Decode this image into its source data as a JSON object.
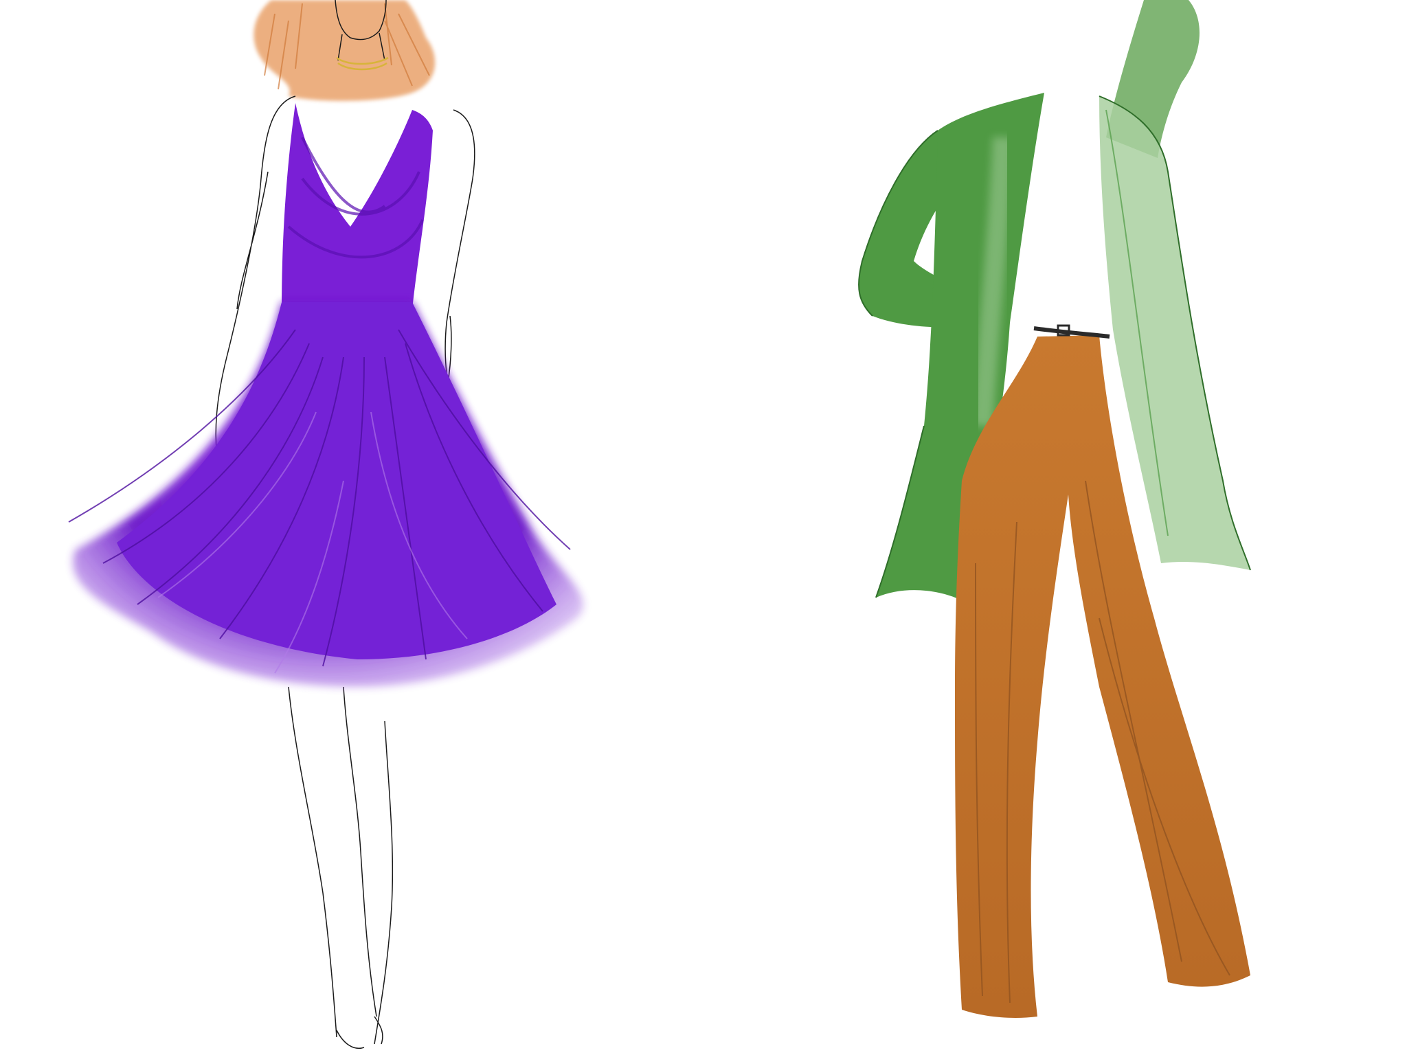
{
  "scene": {
    "kind": "fashion-illustration",
    "background_color": "#ffffff",
    "figures": [
      {
        "id": "figure-left",
        "garment": "purple-feathered-dress",
        "colors": {
          "dress": "#7a1fd6",
          "dress_dark": "#5a0fb0",
          "dress_light": "#b07ae8",
          "hair": "#e9a26a",
          "necklace": "#d8b43a",
          "outline": "#1a1a1a"
        }
      },
      {
        "id": "figure-right",
        "garment": "green-jacket-and-brown-flared-trousers",
        "colors": {
          "jacket": "#4f9a43",
          "jacket_light": "#a9d0a0",
          "trousers": "#c7792e",
          "trousers_dark": "#8f5220",
          "belt": "#2a2a2a",
          "outline": "#2f6e2a"
        }
      }
    ]
  }
}
